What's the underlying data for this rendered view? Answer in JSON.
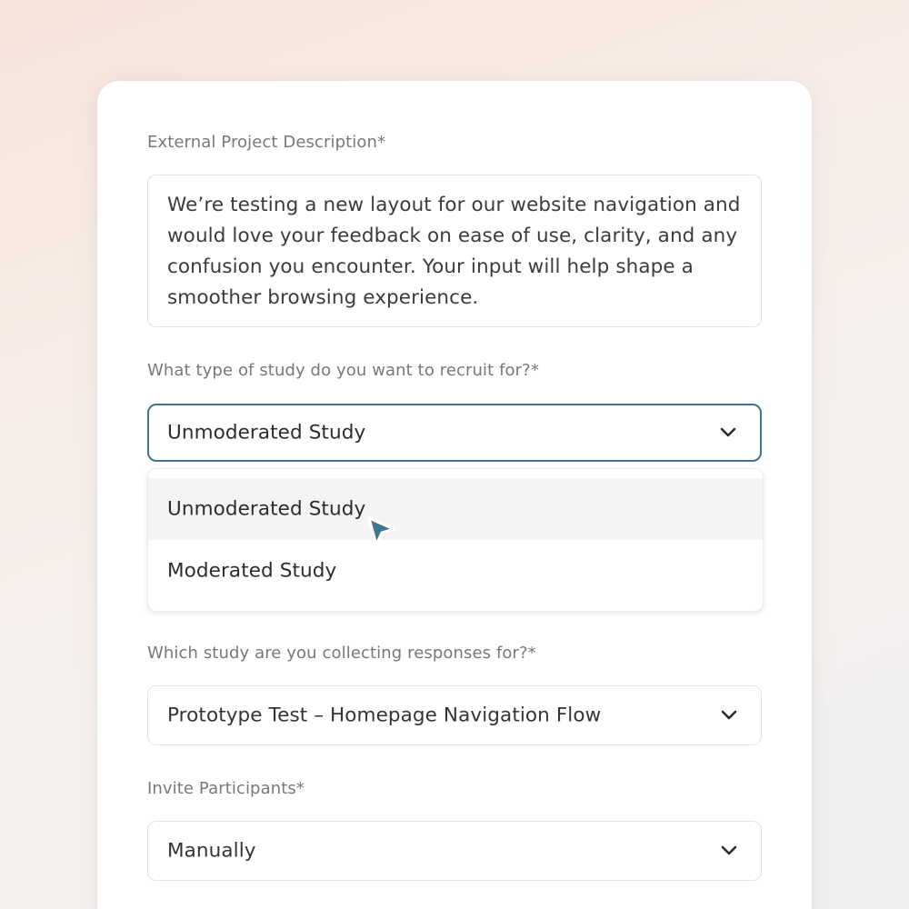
{
  "form": {
    "description": {
      "label": "External Project Description*",
      "value": "We’re testing a new layout for our website navigation and would love your feedback on ease of use, clarity, and any confusion you encounter. Your input will help shape a smoother browsing experience."
    },
    "study_type": {
      "label": "What type of study do you want to recruit for?*",
      "selected": "Unmoderated Study",
      "options": [
        "Unmoderated Study",
        "Moderated Study"
      ],
      "hovered_option": "Unmoderated Study"
    },
    "study": {
      "label": "Which study are you collecting responses for?*",
      "selected": "Prototype Test – Homepage Navigation Flow"
    },
    "invite": {
      "label": "Invite Participants*",
      "selected": "Manually"
    }
  },
  "colors": {
    "focus_border": "#3f7390",
    "cursor": "#41768f"
  },
  "icons": {
    "dropdown": "chevron-down-icon",
    "pointer": "cursor-arrow-icon"
  }
}
